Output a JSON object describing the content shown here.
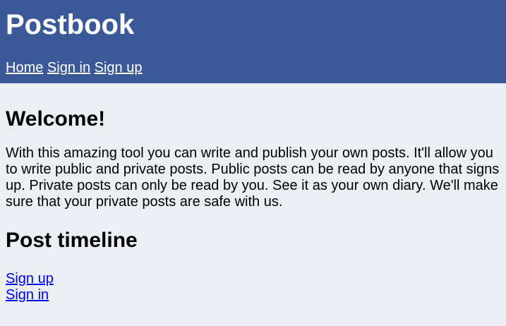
{
  "header": {
    "brand": "Postbook",
    "nav": [
      {
        "label": "Home"
      },
      {
        "label": "Sign in"
      },
      {
        "label": "Sign up"
      }
    ]
  },
  "main": {
    "welcome_heading": "Welcome!",
    "intro_text": "With this amazing tool you can write and publish your own posts. It'll allow you to write public and private posts. Public posts can be read by anyone that signs up. Private posts can only be read by you. See it as your own diary. We'll make sure that your private posts are safe with us.",
    "timeline_heading": "Post timeline",
    "links": [
      {
        "label": "Sign up"
      },
      {
        "label": "Sign in"
      }
    ]
  },
  "colors": {
    "header_bg": "#3b5998",
    "page_bg": "#ebeef3",
    "link": "#0000ee",
    "header_text": "#ffffff"
  }
}
